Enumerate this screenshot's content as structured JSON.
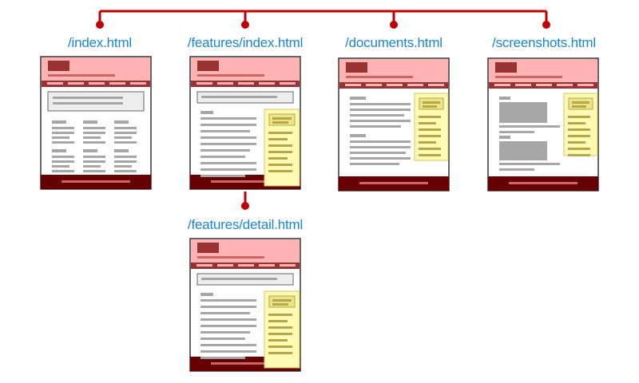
{
  "colors": {
    "connector": "#c00000",
    "label": "#1a86d0",
    "header_bg": "#ffb3b3",
    "logo": "#993333",
    "navbar": "#993333",
    "nav_item": "#ffb3b3",
    "footer": "#660000",
    "footer_line": "#cc6666",
    "text_line": "#a6a6a6",
    "sidebar_bg": "#fff9b3",
    "sidebar_border": "#cccc66",
    "sidebar_box": "#efe38a",
    "sidebar_line": "#b3a84a",
    "frame": "#333333"
  },
  "pages": [
    {
      "id": "index",
      "label": "/index.html",
      "layout": "grid"
    },
    {
      "id": "features-index",
      "label": "/features/index.html",
      "layout": "search-sidebar"
    },
    {
      "id": "documents",
      "label": "/documents.html",
      "layout": "text-sidebar"
    },
    {
      "id": "screenshots",
      "label": "/screenshots.html",
      "layout": "images-sidebar"
    },
    {
      "id": "features-detail",
      "label": "/features/detail.html",
      "layout": "search-sidebar"
    }
  ],
  "connections": [
    {
      "from": "root",
      "to": "index"
    },
    {
      "from": "root",
      "to": "features-index"
    },
    {
      "from": "root",
      "to": "documents"
    },
    {
      "from": "root",
      "to": "screenshots"
    },
    {
      "from": "features-index",
      "to": "features-detail"
    }
  ]
}
